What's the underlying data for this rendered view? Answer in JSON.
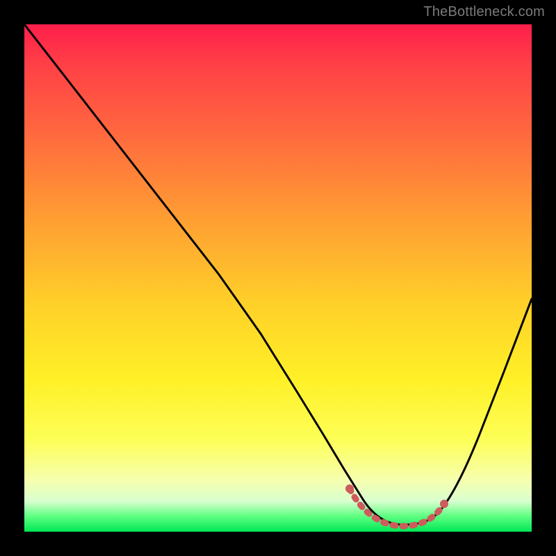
{
  "watermark": "TheBottleneck.com",
  "chart_data": {
    "type": "line",
    "title": "",
    "xlabel": "",
    "ylabel": "",
    "xlim": [
      0,
      100
    ],
    "ylim": [
      0,
      100
    ],
    "x": [
      0,
      5,
      10,
      15,
      20,
      25,
      30,
      35,
      40,
      45,
      50,
      55,
      60,
      64,
      68,
      72,
      76,
      80,
      84,
      88,
      92,
      96,
      100
    ],
    "values": [
      100,
      92,
      84,
      76,
      68,
      60,
      52,
      44,
      36,
      29,
      22,
      16,
      10,
      6,
      3,
      2,
      2,
      3,
      8,
      16,
      26,
      38,
      50
    ],
    "highlight_band_x": [
      62,
      80
    ],
    "highlight_band_y": 3,
    "colors": {
      "curve": "#000000",
      "highlight": "#cd5c5c",
      "gradient_top": "#ff1e4b",
      "gradient_bottom": "#00e756"
    }
  }
}
